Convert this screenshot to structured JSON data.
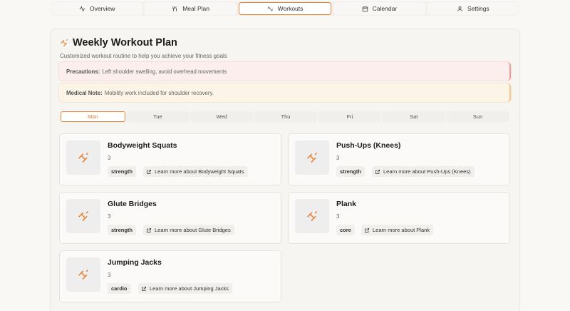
{
  "nav": {
    "tabs": [
      {
        "label": "Overview",
        "icon": "activity-icon"
      },
      {
        "label": "Meal Plan",
        "icon": "utensils-icon"
      },
      {
        "label": "Workouts",
        "icon": "dumbbell-icon"
      },
      {
        "label": "Calendar",
        "icon": "calendar-icon"
      },
      {
        "label": "Settings",
        "icon": "user-icon"
      }
    ],
    "active": "Workouts"
  },
  "page": {
    "title": "Weekly Workout Plan",
    "subtitle": "Customized workout routine to help you achieve your fitness goals"
  },
  "alerts": {
    "precautions_label": "Precautions:",
    "precautions_text": "Left shoulder swelling, avoid overhead movements",
    "medical_label": "Medical Note:",
    "medical_text": "Mobility work included for shoulder recovery."
  },
  "days": [
    "Mon",
    "Tue",
    "Wed",
    "Thu",
    "Fri",
    "Sat",
    "Sun"
  ],
  "selected_day": "Mon",
  "exercises": [
    {
      "name": "Bodyweight Squats",
      "sets": "3",
      "category": "strength",
      "link": "Learn more about Bodyweight Squats"
    },
    {
      "name": "Push-Ups (Knees)",
      "sets": "3",
      "category": "strength",
      "link": "Learn more about Push-Ups (Knees)"
    },
    {
      "name": "Glute Bridges",
      "sets": "3",
      "category": "strength",
      "link": "Learn more about Glute Bridges"
    },
    {
      "name": "Plank",
      "sets": "3",
      "category": "core",
      "link": "Learn more about Plank"
    },
    {
      "name": "Jumping Jacks",
      "sets": "3",
      "category": "cardio",
      "link": "Learn more about Jumping Jacks"
    }
  ],
  "colors": {
    "accent": "#e8833a",
    "background": "#faf8f5"
  }
}
